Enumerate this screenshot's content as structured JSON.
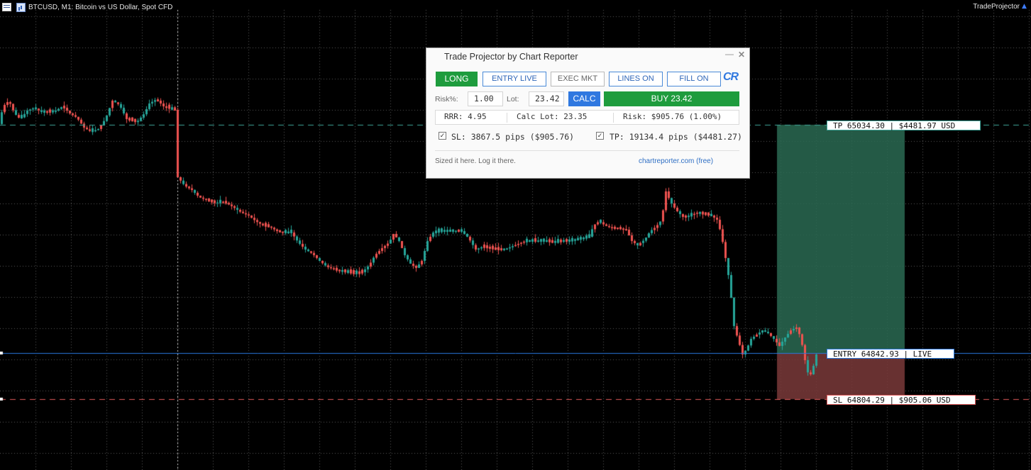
{
  "window": {
    "symbol_title": "BTCUSD, M1:  Bitcoin vs US Dollar, Spot CFD",
    "ea_name": "TradeProjector",
    "ea_icon": "hat-icon"
  },
  "colors": {
    "background": "#000000",
    "grid": "#5a5a5a",
    "bull_candle": "#26a69a",
    "bear_candle": "#ef5350",
    "tp_line": "#3fa69a",
    "entry_line": "#2a79e0",
    "sl_line": "#e05a5a",
    "tp_zone": "#2a6a52",
    "sl_zone": "#7a3a3a",
    "long_button": "#1e9c3d",
    "calc_button": "#2f78e0"
  },
  "levels": {
    "tp": {
      "price": 65034.3,
      "label": "TP 65034.30 | $4481.97 USD"
    },
    "entry": {
      "price": 64842.93,
      "label": "ENTRY 64842.93 | LIVE"
    },
    "sl": {
      "price": 64804.29,
      "label": "SL 64804.29 | $905.06 USD"
    }
  },
  "panel": {
    "title": "Trade Projector by Chart Reporter",
    "buttons": {
      "long": "LONG",
      "entry_live": "ENTRY LIVE",
      "exec_mkt": "EXEC MKT",
      "lines_on": "LINES ON",
      "fill_on": "FILL ON",
      "calc": "CALC",
      "buy": "BUY 23.42"
    },
    "logo": "CR",
    "risk_label": "Risk%:",
    "risk_value": "1.00",
    "lot_label": "Lot:",
    "lot_value": "23.42",
    "stats": {
      "rrr": "RRR: 4.95",
      "calc_lot": "Calc Lot: 23.35",
      "risk": "Risk: $905.76 (1.00%)"
    },
    "sl_check": {
      "checked": true,
      "mark": "✓",
      "text": "SL: 3867.5 pips ($905.76)"
    },
    "tp_check": {
      "checked": true,
      "mark": "✓",
      "text": "TP: 19134.4 pips ($4481.27)"
    },
    "tagline": "Sized it here. Log it there.",
    "site": "chartreporter.com (free)"
  }
}
